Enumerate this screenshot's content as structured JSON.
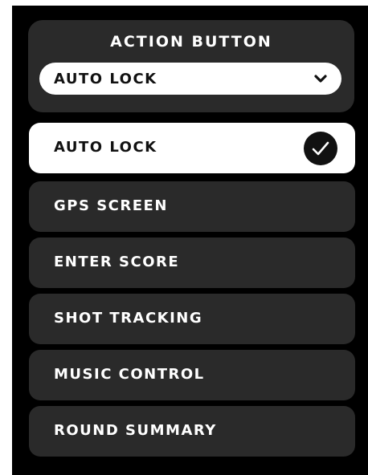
{
  "header": {
    "title": "ACTION BUTTON",
    "selected_value": "AUTO LOCK",
    "dropdown_icon": "chevron-down-icon"
  },
  "options": [
    {
      "label": "AUTO LOCK",
      "selected": true,
      "icon": "check-circle-icon"
    },
    {
      "label": "GPS SCREEN",
      "selected": false
    },
    {
      "label": "ENTER SCORE",
      "selected": false
    },
    {
      "label": "SHOT TRACKING",
      "selected": false
    },
    {
      "label": "MUSIC CONTROL",
      "selected": false
    },
    {
      "label": "ROUND SUMMARY",
      "selected": false
    }
  ],
  "colors": {
    "background": "#000000",
    "card": "#2a2a2a",
    "selected": "#ffffff",
    "text_light": "#ffffff",
    "text_dark": "#111111"
  }
}
